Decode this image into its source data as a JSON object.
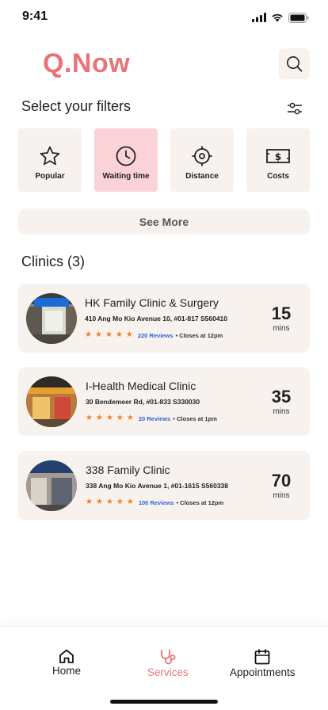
{
  "status": {
    "time": "9:41"
  },
  "app": {
    "logo": "Q.Now",
    "accent": "#e8737b"
  },
  "filters": {
    "title": "Select your filters",
    "items": [
      {
        "label": "Popular",
        "icon": "star-icon",
        "active": false
      },
      {
        "label": "Waiting time",
        "icon": "clock-icon",
        "active": true
      },
      {
        "label": "Distance",
        "icon": "crosshair-icon",
        "active": false
      },
      {
        "label": "Costs",
        "icon": "dollar-bill-icon",
        "active": false
      }
    ],
    "see_more": "See More"
  },
  "clinics": {
    "title": "Clinics (3)",
    "items": [
      {
        "name": "HK Family Clinic & Surgery",
        "address": "410 Ang Mo Kio Avenue 10, #01-817 S560410",
        "rating": 5,
        "reviews": "220 Reviews",
        "closes": "• Closes at 12pm",
        "wait": "15",
        "unit": "mins"
      },
      {
        "name": "I-Health Medical Clinic",
        "address": "30 Bendemeer Rd, #01-833 S330030",
        "rating": 5,
        "reviews": "20 Reviews",
        "closes": "• Closes at 1pm",
        "wait": "35",
        "unit": "mins"
      },
      {
        "name": "338 Family Clinic",
        "address": "338 Ang Mo Kio Avenue 1, #01-1615 S560338",
        "rating": 5,
        "reviews": "100 Reviews",
        "closes": "• Closes at 12pm",
        "wait": "70",
        "unit": "mins"
      }
    ]
  },
  "tabbar": {
    "items": [
      {
        "label": "Home",
        "icon": "home-icon",
        "active": false
      },
      {
        "label": "Services",
        "icon": "stethoscope-icon",
        "active": true
      },
      {
        "label": "Appointments",
        "icon": "calendar-icon",
        "active": false
      }
    ]
  }
}
